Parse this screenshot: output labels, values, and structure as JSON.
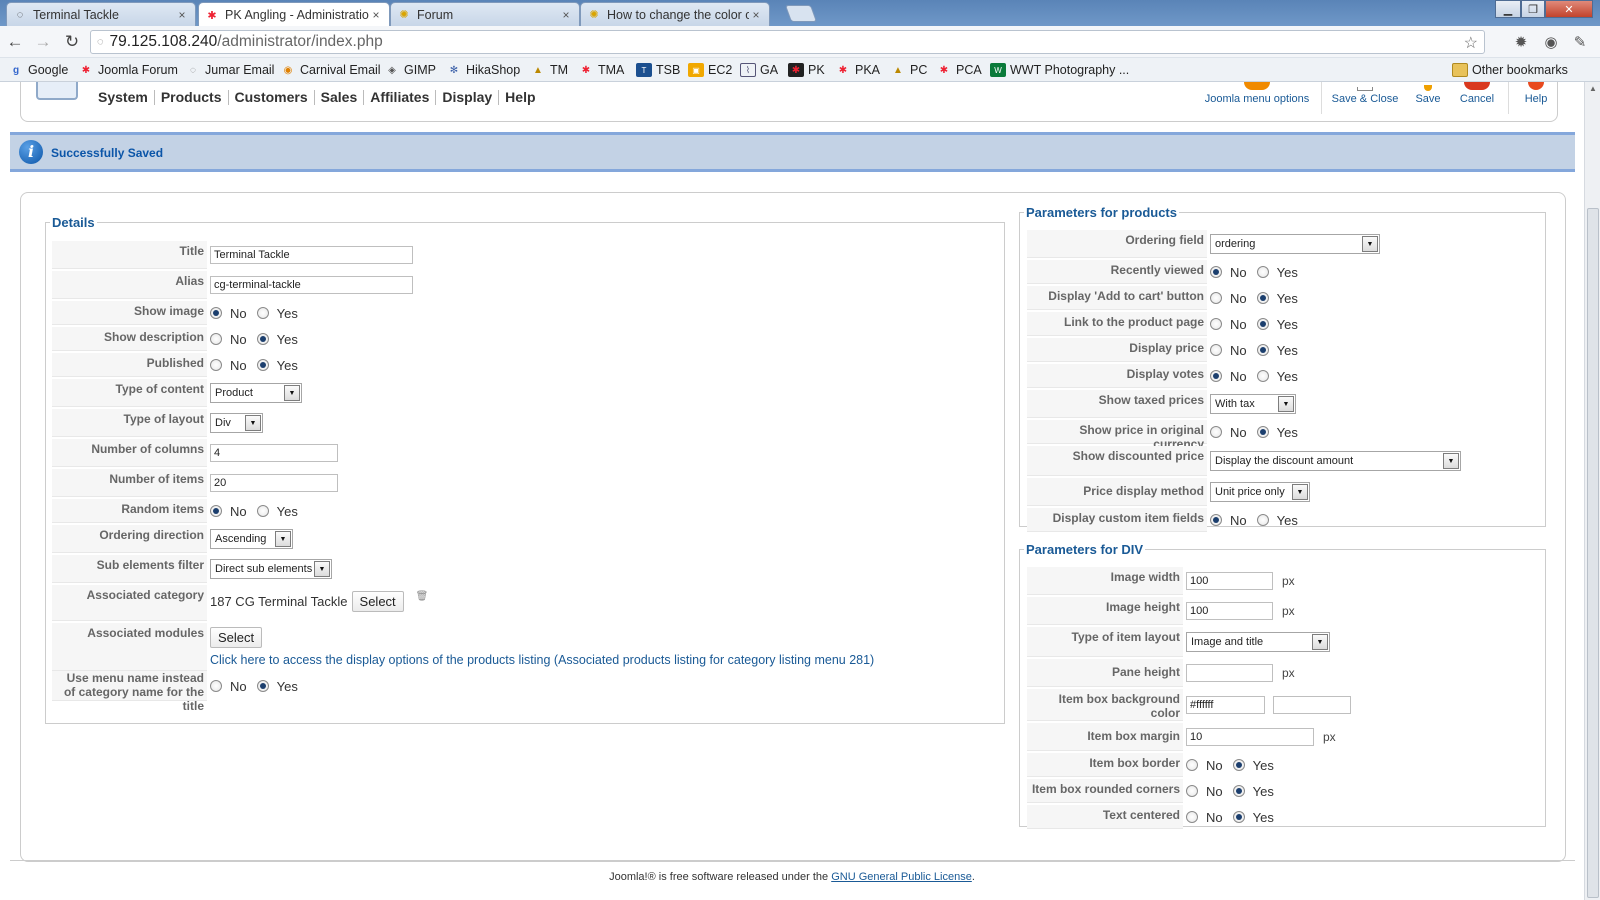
{
  "browser": {
    "tabs": [
      {
        "title": "Terminal Tackle",
        "active": false
      },
      {
        "title": "PK Angling - Administratio",
        "active": true
      },
      {
        "title": "Forum",
        "active": false
      },
      {
        "title": "How to change the color or",
        "active": false
      }
    ],
    "url_host": "79.125.108.240",
    "url_path": "/administrator/index.php",
    "bookmarks": [
      "Google",
      "Joomla Forum",
      "Jumar Email",
      "Carnival Email",
      "GIMP",
      "HikaShop",
      "TM",
      "TMA",
      "TSB",
      "EC2",
      "GA",
      "PK",
      "PKA",
      "PC",
      "PCA",
      "WWT Photography ..."
    ],
    "other_bookmarks": "Other bookmarks"
  },
  "header": {
    "menu": [
      "System",
      "Products",
      "Customers",
      "Sales",
      "Affiliates",
      "Display",
      "Help"
    ],
    "actions": [
      "Joomla menu options",
      "Save & Close",
      "Save",
      "Cancel",
      "Help"
    ]
  },
  "message": "Successfully Saved",
  "details": {
    "legend": "Details",
    "title_label": "Title",
    "title_value": "Terminal Tackle",
    "alias_label": "Alias",
    "alias_value": "cg-terminal-tackle",
    "show_image_label": "Show image",
    "show_description_label": "Show description",
    "published_label": "Published",
    "type_content_label": "Type of content",
    "type_content_value": "Product",
    "type_layout_label": "Type of layout",
    "type_layout_value": "Div",
    "num_columns_label": "Number of columns",
    "num_columns_value": "4",
    "num_items_label": "Number of items",
    "num_items_value": "20",
    "random_items_label": "Random items",
    "ordering_direction_label": "Ordering direction",
    "ordering_direction_value": "Ascending",
    "sub_filter_label": "Sub elements filter",
    "sub_filter_value": "Direct sub elements",
    "assoc_category_label": "Associated category",
    "assoc_category_value": "187 CG Terminal Tackle",
    "assoc_modules_label": "Associated modules",
    "select_label": "Select",
    "listing_link": "Click here to access the display options of the products listing (Associated products listing for category listing menu 281)",
    "use_menu_name_label": "Use menu name instead of category name for the title",
    "no": "No",
    "yes": "Yes"
  },
  "params_products": {
    "legend": "Parameters for products",
    "ordering_field_label": "Ordering field",
    "ordering_field_value": "ordering",
    "recently_viewed_label": "Recently viewed",
    "add_to_cart_label": "Display 'Add to cart' button",
    "link_product_label": "Link to the product page",
    "display_price_label": "Display price",
    "display_votes_label": "Display votes",
    "taxed_prices_label": "Show taxed prices",
    "taxed_prices_value": "With tax",
    "orig_currency_label": "Show price in original currency",
    "discounted_label": "Show discounted price",
    "discounted_value": "Display the discount amount",
    "price_method_label": "Price display method",
    "price_method_value": "Unit price only",
    "custom_fields_label": "Display custom item fields"
  },
  "params_div": {
    "legend": "Parameters for DIV",
    "image_width_label": "Image width",
    "image_width_value": "100",
    "image_height_label": "Image height",
    "image_height_value": "100",
    "item_layout_label": "Type of item layout",
    "item_layout_value": "Image and title",
    "pane_height_label": "Pane height",
    "pane_height_value": "",
    "bg_color_label": "Item box background color",
    "bg_color_value": "#ffffff",
    "margin_label": "Item box margin",
    "margin_value": "10",
    "border_label": "Item box border",
    "rounded_label": "Item box rounded corners",
    "centered_label": "Text centered",
    "px": "px"
  },
  "footer": {
    "pre": "Joomla!® is free software released under the ",
    "link": "GNU General Public License",
    "post": "."
  }
}
